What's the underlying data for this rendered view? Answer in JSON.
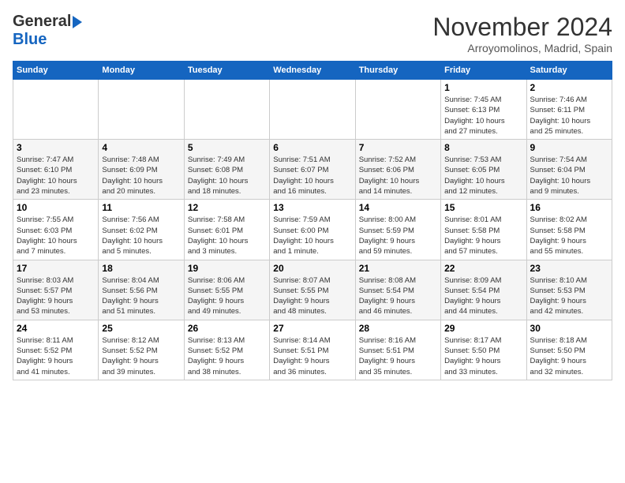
{
  "header": {
    "logo_general": "General",
    "logo_blue": "Blue",
    "month_title": "November 2024",
    "location": "Arroyomolinos, Madrid, Spain"
  },
  "days_of_week": [
    "Sunday",
    "Monday",
    "Tuesday",
    "Wednesday",
    "Thursday",
    "Friday",
    "Saturday"
  ],
  "weeks": [
    [
      {
        "day": "",
        "info": ""
      },
      {
        "day": "",
        "info": ""
      },
      {
        "day": "",
        "info": ""
      },
      {
        "day": "",
        "info": ""
      },
      {
        "day": "",
        "info": ""
      },
      {
        "day": "1",
        "info": "Sunrise: 7:45 AM\nSunset: 6:13 PM\nDaylight: 10 hours\nand 27 minutes."
      },
      {
        "day": "2",
        "info": "Sunrise: 7:46 AM\nSunset: 6:11 PM\nDaylight: 10 hours\nand 25 minutes."
      }
    ],
    [
      {
        "day": "3",
        "info": "Sunrise: 7:47 AM\nSunset: 6:10 PM\nDaylight: 10 hours\nand 23 minutes."
      },
      {
        "day": "4",
        "info": "Sunrise: 7:48 AM\nSunset: 6:09 PM\nDaylight: 10 hours\nand 20 minutes."
      },
      {
        "day": "5",
        "info": "Sunrise: 7:49 AM\nSunset: 6:08 PM\nDaylight: 10 hours\nand 18 minutes."
      },
      {
        "day": "6",
        "info": "Sunrise: 7:51 AM\nSunset: 6:07 PM\nDaylight: 10 hours\nand 16 minutes."
      },
      {
        "day": "7",
        "info": "Sunrise: 7:52 AM\nSunset: 6:06 PM\nDaylight: 10 hours\nand 14 minutes."
      },
      {
        "day": "8",
        "info": "Sunrise: 7:53 AM\nSunset: 6:05 PM\nDaylight: 10 hours\nand 12 minutes."
      },
      {
        "day": "9",
        "info": "Sunrise: 7:54 AM\nSunset: 6:04 PM\nDaylight: 10 hours\nand 9 minutes."
      }
    ],
    [
      {
        "day": "10",
        "info": "Sunrise: 7:55 AM\nSunset: 6:03 PM\nDaylight: 10 hours\nand 7 minutes."
      },
      {
        "day": "11",
        "info": "Sunrise: 7:56 AM\nSunset: 6:02 PM\nDaylight: 10 hours\nand 5 minutes."
      },
      {
        "day": "12",
        "info": "Sunrise: 7:58 AM\nSunset: 6:01 PM\nDaylight: 10 hours\nand 3 minutes."
      },
      {
        "day": "13",
        "info": "Sunrise: 7:59 AM\nSunset: 6:00 PM\nDaylight: 10 hours\nand 1 minute."
      },
      {
        "day": "14",
        "info": "Sunrise: 8:00 AM\nSunset: 5:59 PM\nDaylight: 9 hours\nand 59 minutes."
      },
      {
        "day": "15",
        "info": "Sunrise: 8:01 AM\nSunset: 5:58 PM\nDaylight: 9 hours\nand 57 minutes."
      },
      {
        "day": "16",
        "info": "Sunrise: 8:02 AM\nSunset: 5:58 PM\nDaylight: 9 hours\nand 55 minutes."
      }
    ],
    [
      {
        "day": "17",
        "info": "Sunrise: 8:03 AM\nSunset: 5:57 PM\nDaylight: 9 hours\nand 53 minutes."
      },
      {
        "day": "18",
        "info": "Sunrise: 8:04 AM\nSunset: 5:56 PM\nDaylight: 9 hours\nand 51 minutes."
      },
      {
        "day": "19",
        "info": "Sunrise: 8:06 AM\nSunset: 5:55 PM\nDaylight: 9 hours\nand 49 minutes."
      },
      {
        "day": "20",
        "info": "Sunrise: 8:07 AM\nSunset: 5:55 PM\nDaylight: 9 hours\nand 48 minutes."
      },
      {
        "day": "21",
        "info": "Sunrise: 8:08 AM\nSunset: 5:54 PM\nDaylight: 9 hours\nand 46 minutes."
      },
      {
        "day": "22",
        "info": "Sunrise: 8:09 AM\nSunset: 5:54 PM\nDaylight: 9 hours\nand 44 minutes."
      },
      {
        "day": "23",
        "info": "Sunrise: 8:10 AM\nSunset: 5:53 PM\nDaylight: 9 hours\nand 42 minutes."
      }
    ],
    [
      {
        "day": "24",
        "info": "Sunrise: 8:11 AM\nSunset: 5:52 PM\nDaylight: 9 hours\nand 41 minutes."
      },
      {
        "day": "25",
        "info": "Sunrise: 8:12 AM\nSunset: 5:52 PM\nDaylight: 9 hours\nand 39 minutes."
      },
      {
        "day": "26",
        "info": "Sunrise: 8:13 AM\nSunset: 5:52 PM\nDaylight: 9 hours\nand 38 minutes."
      },
      {
        "day": "27",
        "info": "Sunrise: 8:14 AM\nSunset: 5:51 PM\nDaylight: 9 hours\nand 36 minutes."
      },
      {
        "day": "28",
        "info": "Sunrise: 8:16 AM\nSunset: 5:51 PM\nDaylight: 9 hours\nand 35 minutes."
      },
      {
        "day": "29",
        "info": "Sunrise: 8:17 AM\nSunset: 5:50 PM\nDaylight: 9 hours\nand 33 minutes."
      },
      {
        "day": "30",
        "info": "Sunrise: 8:18 AM\nSunset: 5:50 PM\nDaylight: 9 hours\nand 32 minutes."
      }
    ]
  ]
}
